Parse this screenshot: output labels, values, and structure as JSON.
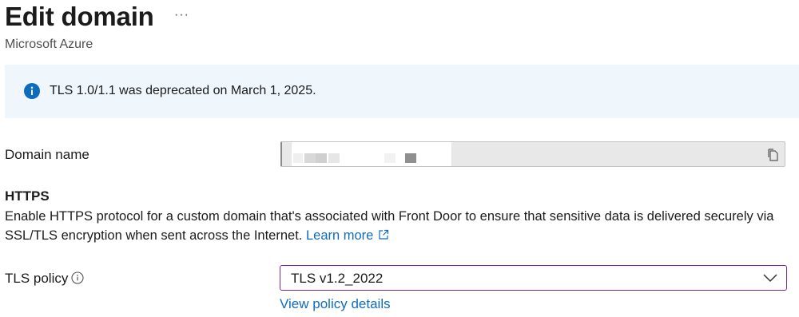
{
  "header": {
    "title": "Edit domain",
    "more_label": "···",
    "subtitle": "Microsoft Azure"
  },
  "banner": {
    "icon": "info-icon",
    "message": "TLS 1.0/1.1 was deprecated on March 1, 2025.",
    "color": "#0f6cbd",
    "background": "#eff6fc"
  },
  "domain": {
    "label": "Domain name",
    "value": "",
    "copy_icon": "copy-icon"
  },
  "https": {
    "title": "HTTPS",
    "description": "Enable HTTPS protocol for a custom domain that's associated with Front Door to ensure that sensitive data is delivered securely via SSL/TLS encryption when sent across the Internet.",
    "learn_more": "Learn more",
    "link_color": "#0f6cbd"
  },
  "tls": {
    "label": "TLS policy",
    "selected": "TLS v1.2_2022",
    "view_details": "View policy details",
    "focus_border_color": "#7b2b8f"
  }
}
